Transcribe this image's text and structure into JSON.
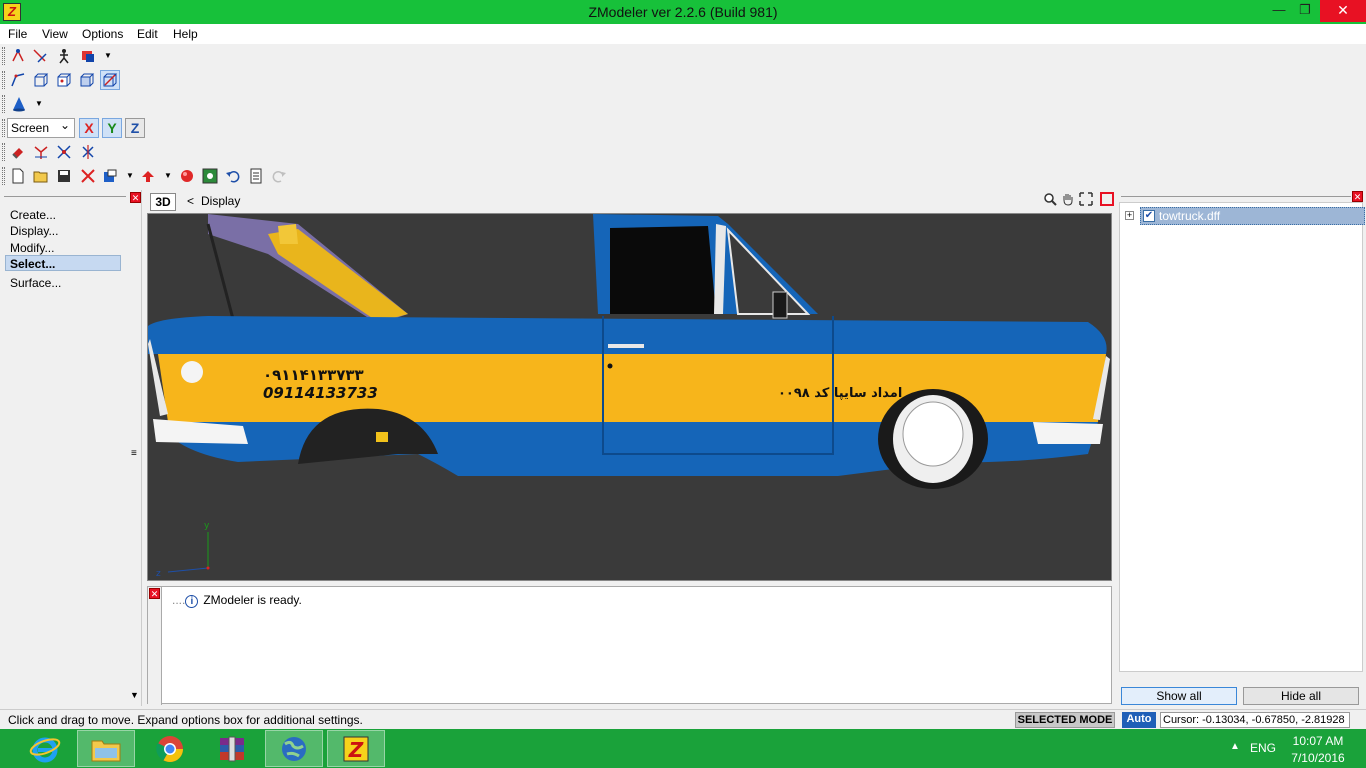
{
  "window": {
    "title": "ZModeler ver 2.2.6 (Build 981)",
    "app_icon": "Z"
  },
  "menu": {
    "items": [
      "File",
      "View",
      "Options",
      "Edit",
      "Help"
    ]
  },
  "toolbar": {
    "coord_select": "Screen",
    "axes": [
      "X",
      "Y",
      "Z"
    ]
  },
  "left_panel": {
    "items": [
      "Create...",
      "Display...",
      "Modify...",
      "Select...",
      "Surface..."
    ],
    "selected": "Select..."
  },
  "viewport": {
    "mode_label": "3D",
    "nav_arrow": "<",
    "display_label": "Display",
    "car_text": {
      "phone_fa": "۰۹۱۱۴۱۳۳۷۳۳",
      "phone": "09114133733",
      "door_text": "امداد سایپا  کد ۰۰۹۸"
    },
    "axis_labels": {
      "y": "y",
      "z": "z"
    }
  },
  "log": {
    "message": "ZModeler is ready."
  },
  "right_panel": {
    "tree_item": "towtruck.dff",
    "expand": "+",
    "show_all": "Show all",
    "hide_all": "Hide all"
  },
  "status": {
    "hint": "Click and drag to move. Expand options box for additional settings.",
    "mode": "SELECTED MODE",
    "auto": "Auto",
    "cursor": "Cursor: -0.13034, -0.67850, -2.81928"
  },
  "taskbar": {
    "lang": "ENG",
    "time": "10:07 AM",
    "date": "7/10/2016"
  },
  "colors": {
    "titlebar": "#17c13a",
    "taskbar": "#1aa23a",
    "car_blue": "#1565b8",
    "car_yellow": "#f7b51b",
    "viewport_bg": "#3a3a3a"
  }
}
